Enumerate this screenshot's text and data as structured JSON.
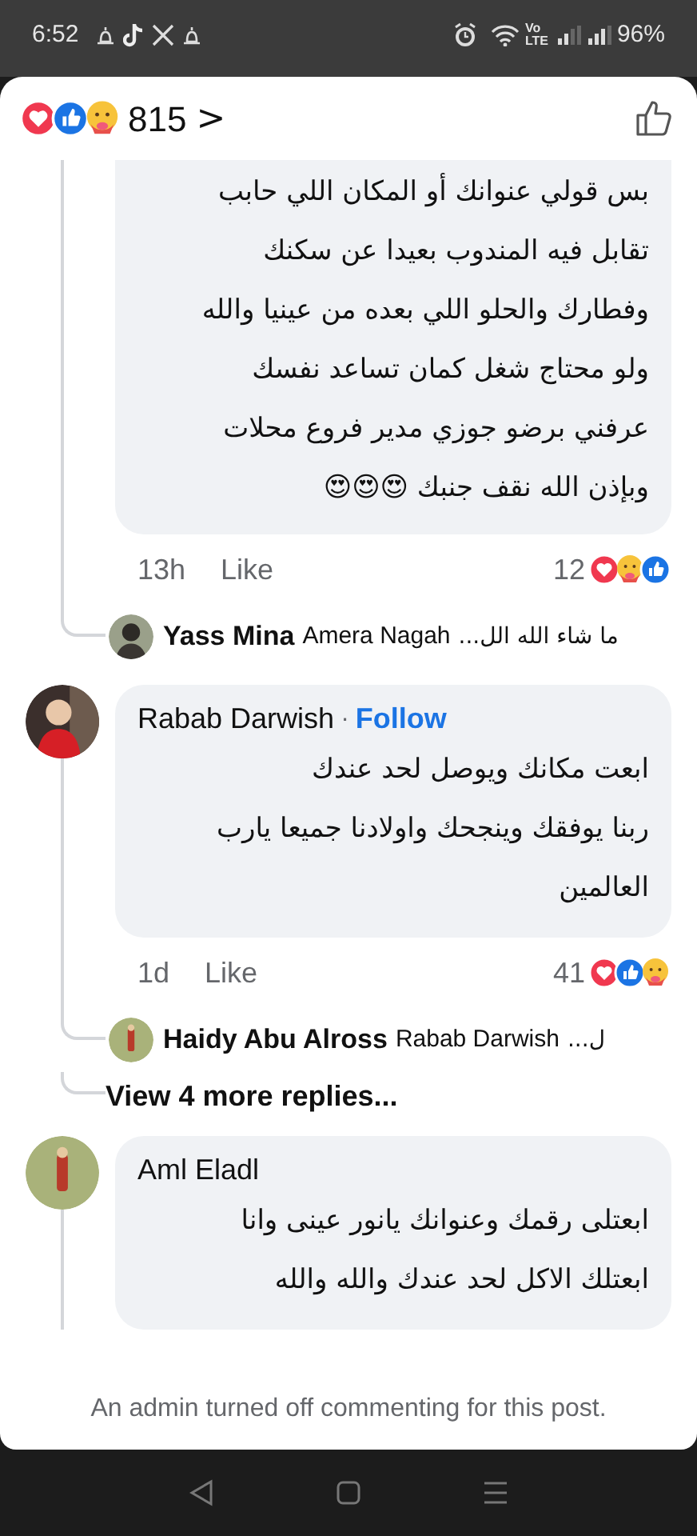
{
  "status_bar": {
    "time": "6:52",
    "volte": [
      "Vo",
      "LTE"
    ],
    "battery": "96%"
  },
  "header": {
    "reactions": [
      {
        "kind": "love"
      },
      {
        "kind": "like"
      },
      {
        "kind": "care"
      }
    ],
    "count": "815",
    "chevron": ">"
  },
  "comments": [
    {
      "text": "بس قولي عنوانك أو المكان اللي حابب\nتقابل فيه المندوب بعيدا عن سكنك\nوفطارك والحلو اللي بعده من عينيا والله\nولو محتاج شغل كمان تساعد نفسك\nعرفني برضو جوزي مدير فروع محلات\nوبإذن الله نقف جنبك 😍😍😍",
      "time": "13h",
      "like": "Like",
      "reaction_count": "12",
      "reactions": [
        {
          "kind": "love"
        },
        {
          "kind": "care"
        },
        {
          "kind": "like"
        }
      ],
      "replies": [
        {
          "name": "Yass Mina",
          "mention": "Amera Nagah",
          "preview": "ما شاء الله الل..."
        }
      ]
    },
    {
      "name": "Rabab Darwish",
      "separator": "·",
      "follow": "Follow",
      "text": "ابعت مكانك ويوصل لحد عندك\nربنا يوفقك وينجحك واولادنا جميعا يارب\nالعالمين",
      "time": "1d",
      "like": "Like",
      "reaction_count": "41",
      "reactions": [
        {
          "kind": "love"
        },
        {
          "kind": "like"
        },
        {
          "kind": "care"
        }
      ],
      "replies": [
        {
          "name": "Haidy Abu Alross",
          "mention": "Rabab Darwish",
          "preview": "ل..."
        }
      ],
      "more_replies": "View 4 more replies..."
    },
    {
      "name": "Aml Eladl",
      "text": "ابعتلى رقمك وعنوانك يانور عينى وانا\nابعتلك الاكل لحد عندك والله والله"
    }
  ],
  "footer": "An admin turned off commenting for this post."
}
